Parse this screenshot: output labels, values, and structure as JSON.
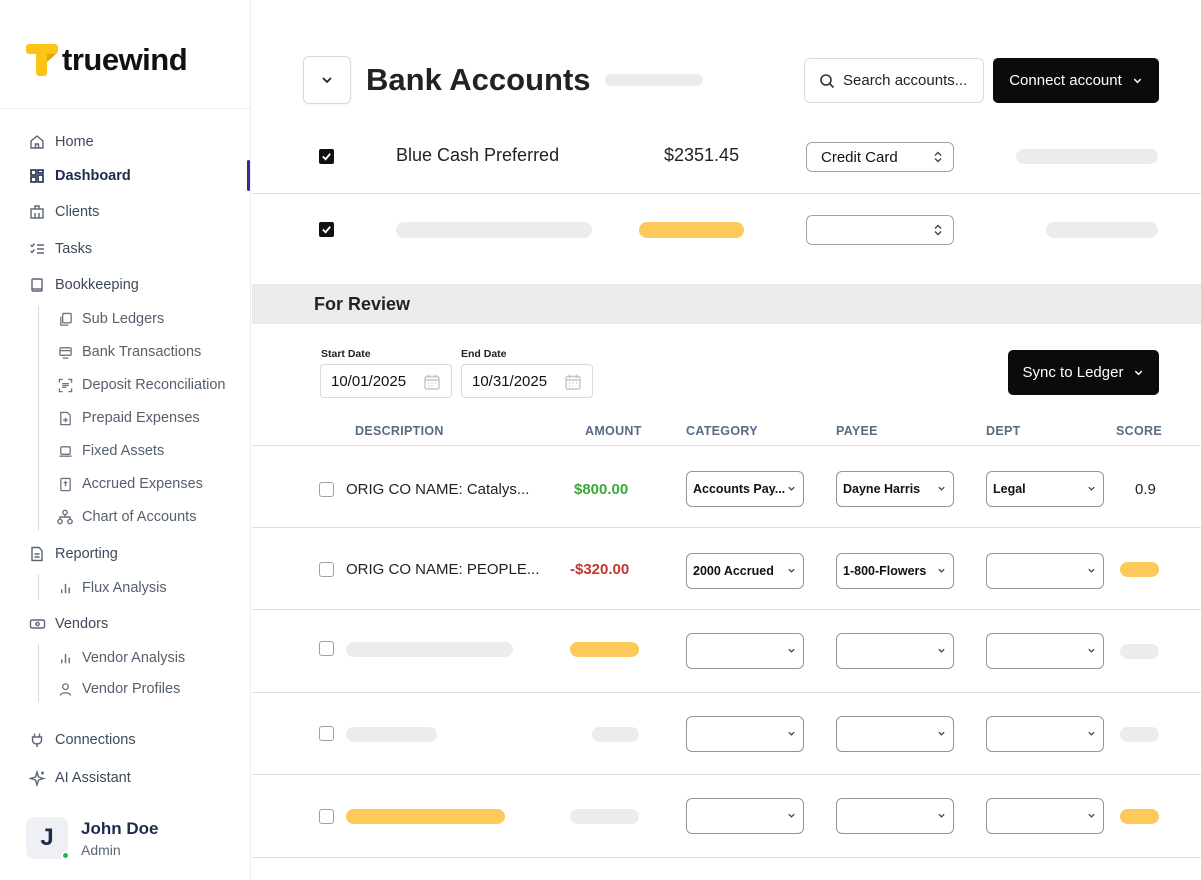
{
  "brand": {
    "name": "truewind",
    "accent": "#fcc419"
  },
  "sidebar": {
    "nav": [
      {
        "label": "Home",
        "icon": "home-icon"
      },
      {
        "label": "Dashboard",
        "icon": "dashboard-icon",
        "active": true
      },
      {
        "label": "Clients",
        "icon": "building-icon"
      },
      {
        "label": "Tasks",
        "icon": "tasks-icon"
      },
      {
        "label": "Bookkeeping",
        "icon": "book-icon"
      }
    ],
    "bookkeeping_items": [
      {
        "label": "Sub Ledgers",
        "icon": "copy-icon"
      },
      {
        "label": "Bank Transactions",
        "icon": "bank-transactions-icon"
      },
      {
        "label": "Deposit Reconciliation",
        "icon": "scan-icon"
      },
      {
        "label": "Prepaid Expenses",
        "icon": "file-plus-icon"
      },
      {
        "label": "Fixed Assets",
        "icon": "laptop-icon"
      },
      {
        "label": "Accrued Expenses",
        "icon": "receipt-icon"
      },
      {
        "label": "Chart of Accounts",
        "icon": "hierarchy-icon"
      }
    ],
    "reporting": {
      "label": "Reporting",
      "icon": "report-icon"
    },
    "reporting_items": [
      {
        "label": "Flux Analysis",
        "icon": "bar-chart-icon"
      }
    ],
    "vendors": {
      "label": "Vendors",
      "icon": "vendor-icon"
    },
    "vendor_items": [
      {
        "label": "Vendor Analysis",
        "icon": "bar-chart-icon"
      },
      {
        "label": "Vendor Profiles",
        "icon": "user-icon"
      }
    ],
    "connections": {
      "label": "Connections",
      "icon": "plug-icon"
    },
    "ai_assistant": {
      "label": "AI Assistant",
      "icon": "sparkle-icon"
    },
    "user": {
      "initial": "J",
      "name": "John Doe",
      "role": "Admin",
      "status_color": "#22b35c"
    }
  },
  "header": {
    "title": "Bank Accounts",
    "search_label": "Search accounts...",
    "connect_label": "Connect account"
  },
  "accounts": [
    {
      "checked": true,
      "name": "Blue Cash Preferred",
      "amount": "$2351.45",
      "type": "Credit Card"
    },
    {
      "checked": true,
      "name": "",
      "amount": "",
      "type": ""
    }
  ],
  "review": {
    "title": "For Review",
    "start_date_label": "Start Date",
    "start_date": "10/01/2025",
    "end_date_label": "End Date",
    "end_date": "10/31/2025",
    "sync_label": "Sync to Ledger",
    "columns": [
      "DESCRIPTION",
      "AMOUNT",
      "CATEGORY",
      "PAYEE",
      "DEPT",
      "SCORE"
    ],
    "rows": [
      {
        "description": "ORIG CO NAME: Catalys...",
        "amount": "$800.00",
        "amount_color": "#3aa935",
        "category": "Accounts Pay...",
        "payee": "Dayne Harris",
        "dept": "Legal",
        "score": "0.9"
      },
      {
        "description": "ORIG CO NAME: PEOPLE...",
        "amount": "-$320.00",
        "amount_color": "#c0392b",
        "category": "2000 Accrued",
        "payee": "1-800-Flowers",
        "dept": "",
        "score": ""
      },
      {
        "description": "",
        "amount": "",
        "category": "",
        "payee": "",
        "dept": "",
        "score": ""
      },
      {
        "description": "",
        "amount": "",
        "category": "",
        "payee": "",
        "dept": "",
        "score": ""
      },
      {
        "description": "",
        "amount": "",
        "category": "",
        "payee": "",
        "dept": "",
        "score": ""
      }
    ]
  }
}
